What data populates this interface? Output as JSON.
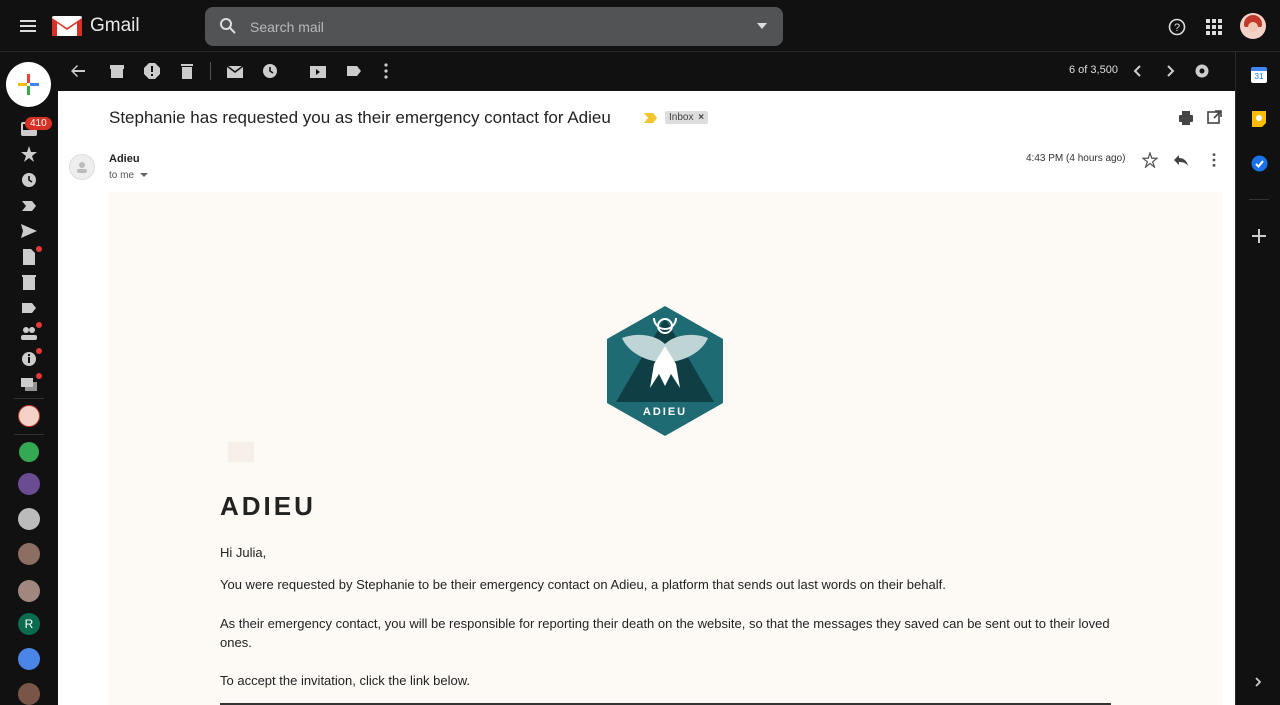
{
  "app": {
    "name": "Gmail"
  },
  "search": {
    "placeholder": "Search mail"
  },
  "left_rail": {
    "inbox_count": "410"
  },
  "toolbar": {
    "pager": "6 of 3,500"
  },
  "email": {
    "subject": "Stephanie has requested you as their emergency contact for Adieu",
    "label": "Inbox",
    "sender": "Adieu",
    "to": "to me",
    "time": "4:43 PM (4 hours ago)",
    "logo_text": "ADIEU",
    "heading": "ADIEU",
    "greeting": "Hi Julia,",
    "para1": "You were requested by Stephanie to be their emergency contact on Adieu, a platform that sends out last words on their behalf.",
    "para2": "As their emergency contact, you will be responsible for reporting their death on the website, so that the messages they saved can be sent out to their loved ones.",
    "para3": "To accept the invitation, click the link below."
  },
  "right_rail": {
    "calendar_day": "31"
  },
  "colors": {
    "accent_red": "#d93025",
    "hex_teal": "#1e6b74",
    "hex_dark": "#0f3e44"
  }
}
